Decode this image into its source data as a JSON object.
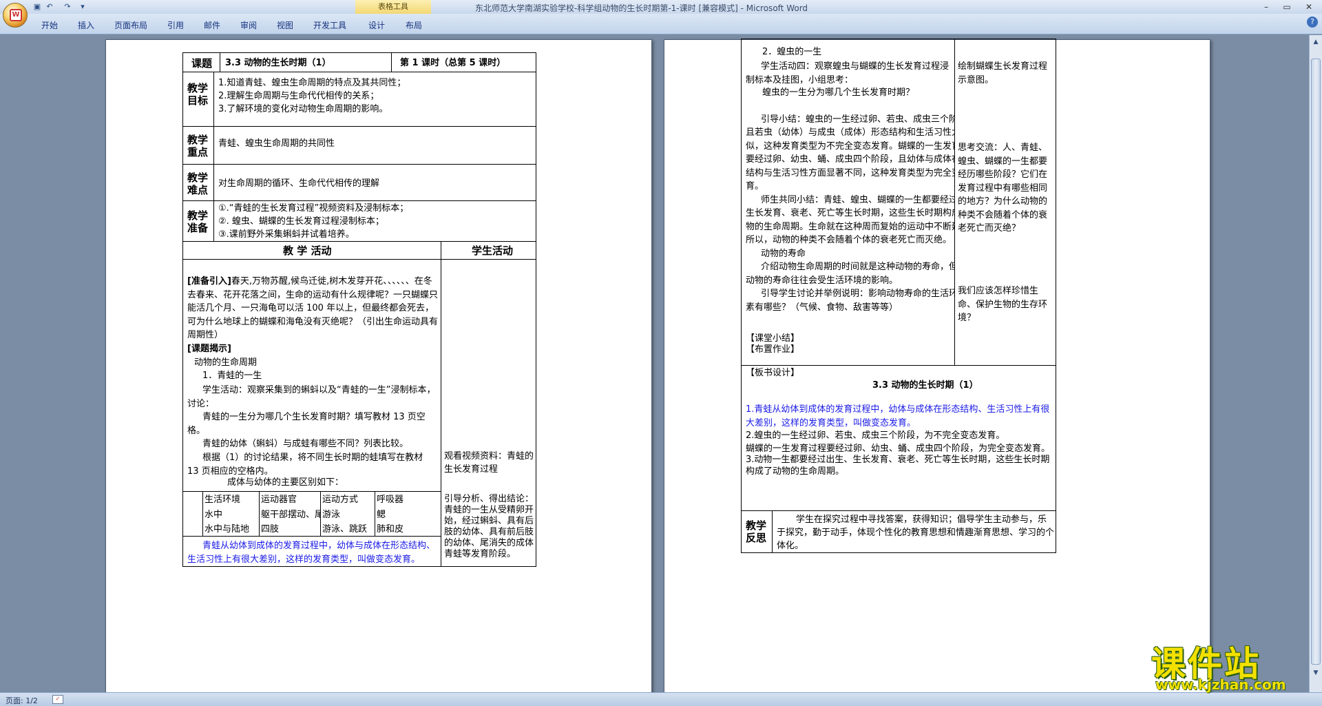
{
  "window": {
    "title": "东北师范大学南湖实验学校-科学组动物的生长时期第-1-课时 [兼容模式] - Microsoft Word",
    "context_tab": "表格工具"
  },
  "ribbon": {
    "tabs": [
      "开始",
      "插入",
      "页面布局",
      "引用",
      "邮件",
      "审阅",
      "视图",
      "开发工具",
      "设计",
      "布局"
    ]
  },
  "status": {
    "page": "页面: 1/2"
  },
  "watermark": {
    "title": "课件站",
    "url": "www.kjzhan.com"
  },
  "page1": {
    "topic_label": "课题",
    "topic_value": "3.3 动物的生长时期（1）",
    "period": "第   1   课时（总第 5   课时）",
    "goals_label": "教学目标",
    "goals": [
      "1.知道青蛙、蝗虫生命周期的特点及其共同性；",
      "2.理解生命周期与生命代代相传的关系；",
      "3.了解环境的变化对动物生命周期的影响。"
    ],
    "key_label": "教学重点",
    "key_text": "青蛙、蝗虫生命周期的共同性",
    "difficulty_label": "教学难点",
    "difficulty_text": "对生命周期的循环、生命代代相传的理解",
    "prep_label": "教学准备",
    "prep": [
      "①.“青蛙的生长发育过程”视频资料及浸制标本；",
      "②. 蝗虫、蝴蝶的生长发育过程浸制标本；",
      "③.课前野外采集蝌蚪并试着培养。"
    ],
    "activity_header": "教 学 活动",
    "student_header": "学生活动",
    "intro_tag": "[准备引入]",
    "intro_text": "春天,万物苏醒,候鸟迁徙,树木发芽开花、、、、、、在冬去春来、花开花落之间，生命的运动有什么规律呢？一只蝴蝶只能活几个月、一只海龟可以活 100 年以上，但最终都会死去，可为什么地球上的蝴蝶和海龟没有灭绝呢？（引出生命运动具有周期性）",
    "reveal_tag": "[课题揭示]",
    "line_cycle": "动物的生命周期",
    "line_frog": "1．青蛙的一生",
    "student_activity": "学生活动：观察采集到的蝌蚪以及“青蛙的一生”浸制标本，讨论：",
    "q1": "青蛙的一生分为哪几个生长发育时期？填写教材 13 页空格。",
    "q2": "青蛙的幼体（蝌蚪）与成蛙有哪些不同？列表比较。",
    "q3": "根据（1）的讨论结果，将不同生长时期的蛙填写在教材 13 页相应的空格内。",
    "table_caption": "成体与幼体的主要区别如下：",
    "diff_table": [
      [
        "生活环境",
        "运动器官",
        "运动方式",
        "呼吸器"
      ],
      [
        "水中",
        "躯干部摆动、尾部",
        "游泳",
        "鳃"
      ],
      [
        "水中与陆地",
        "四肢",
        "游泳、跳跃",
        "肺和皮"
      ]
    ],
    "conclusion_blue": "青蛙从幼体到成体的发育过程中，幼体与成体在形态结构、生活习性上有很大差别，这样的发育类型，叫做变态发育。",
    "side_video": "观看视频资料：青蛙的生长发育过程",
    "side_analysis": "引导分析、得出结论：青蛙的一生从受精卵开始，经过蝌蚪、具有后肢的幼体、具有前后肢的幼体、尾消失的成体青蛙等发育阶段。"
  },
  "page2": {
    "locust_title": "2．蝗虫的一生",
    "activity4": "学生活动四：观察蝗虫与蝴蝶的生长发育过程浸制标本及挂图，小组思考：",
    "locust_q": "蝗虫的一生分为哪几个生长发育时期？",
    "summary_lines": [
      "引导小结：蝗虫的一生经过卵、若虫、成虫三个阶段，",
      "且若虫（幼体）与成虫（成体）形态结构和生活习性大致相",
      "似，这种发育类型为不完全变态发育。蝴蝶的一生发育过程",
      "要经过卵、幼虫、蛹、成虫四个阶段，且幼体与成体在形态",
      "结构与生活习性方面显著不同，这种发育类型为完全变态发",
      "育。"
    ],
    "joint_lines": [
      "师生共同小结：青蛙、蝗虫、蝴蝶的一生都要经过出生、",
      "生长发育、衰老、死亡等生长时期，这些生长时期构成了动",
      "物的生命周期。生命就在这种周而复始的运动中不断延续，",
      "所以，动物的种类不会随着个体的衰老死亡而灭绝。"
    ],
    "lifespan_title": "动物的寿命",
    "lifespan_intro": "介绍动物生命周期的时间就是这种动物的寿命，但是，",
    "lifespan_intro2": "动物的寿命往往会受生活环境的影响。",
    "lifespan_q": "引导学生讨论并举例说明：影响动物寿命的生活环境因",
    "lifespan_q2": "素有哪些？（气候、食物、敌害等等）",
    "class_summary": "【课堂小结】",
    "homework": "【布置作业】",
    "side_draw": "绘制蝴蝶生长发育过程示意图。",
    "side_think": "思考交流：人、青蛙、蝗虫、蝴蝶的一生都要经历哪些阶段？它们在发育过程中有哪些相同的地方？为什么动物的种类不会随着个体的衰老死亡而灭绝？",
    "side_cherish": "我们应该怎样珍惜生命、保护生物的生存环境？",
    "board_label": "【板书设计】",
    "board_title": "3.3 动物的生长时期（1）",
    "board_1": "1.青蛙从幼体到成体的发育过程中，幼体与成体在形态结构、生活习性上有很大差别，这样的发育类型，叫做变态发育。",
    "board_2": "2.蝗虫的一生经过卵、若虫、成虫三个阶段，为不完全变态发育。",
    "board_2b": "蝴蝶的一生发育过程要经过卵、幼虫、蛹、成虫四个阶段，为完全变态发育。",
    "board_3": "3.动物一生都要经过出生、生长发育、衰老、死亡等生长时期，这些生长时期构成了动物的生命周期。",
    "reflect_label": "教学反思",
    "reflect_text": "学生在探究过程中寻找答案，获得知识；倡导学生主动参与，乐于探究，勤于动手，体现个性化的教育思想和情趣渐育思想、学习的个体化。"
  },
  "colors": {
    "accent_blue": "#1a1ae6",
    "workspace": "#7b8da4",
    "watermark_yellow": "#f2e000"
  },
  "icons": [
    "office-button-icon",
    "save-icon",
    "undo-icon",
    "redo-icon",
    "customize-qat-icon",
    "minimize-icon",
    "maximize-icon",
    "close-icon",
    "help-icon"
  ]
}
